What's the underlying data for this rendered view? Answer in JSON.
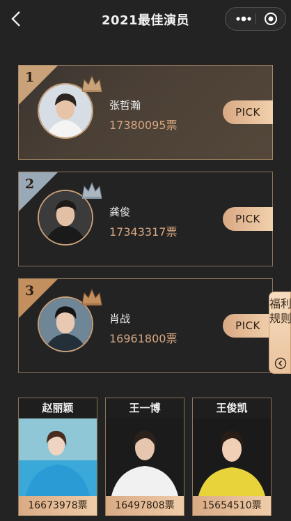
{
  "header": {
    "title": "2021最佳演员",
    "back_icon": "chevron-left-icon",
    "more_icon": "more-dots-icon",
    "close_icon": "target-circle-icon"
  },
  "vote_suffix": "票",
  "pick_label": "PICK",
  "top_candidates": [
    {
      "rank": "1",
      "name": "张哲瀚",
      "votes": "17380095票",
      "badge_color": "#c9a27a"
    },
    {
      "rank": "2",
      "name": "龚俊",
      "votes": "17343317票",
      "badge_color": "#9aa9b8"
    },
    {
      "rank": "3",
      "name": "肖战",
      "votes": "16961800票",
      "badge_color": "#c48f5e"
    }
  ],
  "side_tab": {
    "label": "福利规则",
    "icon": "chevron-left-circle-icon"
  },
  "other_candidates": [
    {
      "name": "赵丽颖",
      "votes": "16673978票"
    },
    {
      "name": "王一博",
      "votes": "16497808票"
    },
    {
      "name": "王俊凯",
      "votes": "15654510票"
    }
  ],
  "colors": {
    "accent": "#d9a882",
    "background": "#232323",
    "border": "#8e7458"
  }
}
